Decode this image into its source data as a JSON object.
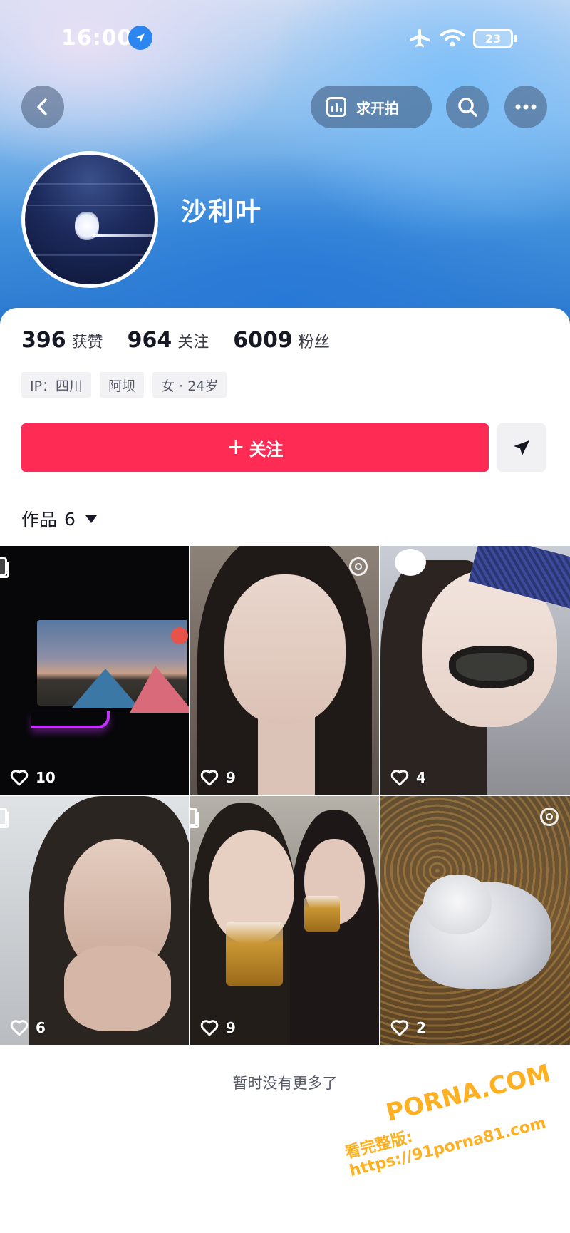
{
  "status_bar": {
    "time": "16:00",
    "battery": "23"
  },
  "header": {
    "creator_button_label": "求开拍",
    "nickname": "沙利叶"
  },
  "stats": [
    {
      "value": "396",
      "label": "获赞"
    },
    {
      "value": "964",
      "label": "关注"
    },
    {
      "value": "6009",
      "label": "粉丝"
    }
  ],
  "tags": [
    "IP：四川",
    "阿坝",
    "女 · 24岁"
  ],
  "actions": {
    "follow_label": "关注"
  },
  "works_tab": {
    "label": "作品",
    "count": "6"
  },
  "videos": [
    {
      "likes": "10",
      "badge": "multi-icon"
    },
    {
      "likes": "9",
      "badge": "live-icon"
    },
    {
      "likes": "4",
      "badge": "none"
    },
    {
      "likes": "6",
      "badge": "multi-icon"
    },
    {
      "likes": "9",
      "badge": "multi-icon"
    },
    {
      "likes": "2",
      "badge": "live-icon"
    }
  ],
  "footer": {
    "no_more_text": "暂时没有更多了"
  },
  "watermark": {
    "brand": "PORNA.COM",
    "url": "看完整版: https://91porna81.com"
  },
  "colors": {
    "accent": "#fe2c55",
    "text_primary": "#161823"
  }
}
